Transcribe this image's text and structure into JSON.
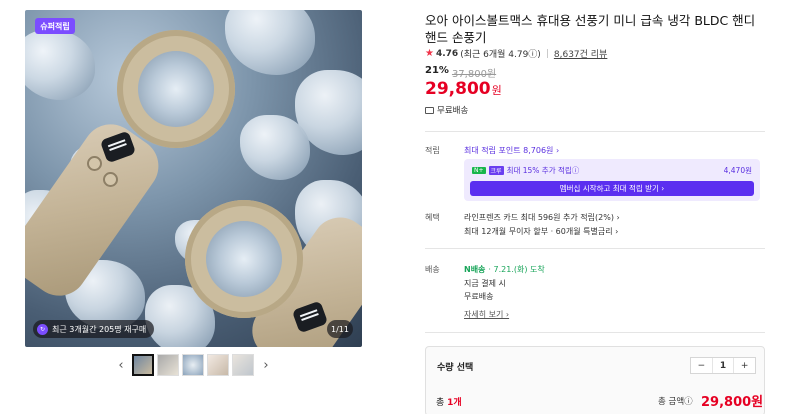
{
  "image": {
    "badge": "슈퍼적립",
    "repurchase_text": "최근 3개월간 205명 재구매",
    "page_counter": "1/11"
  },
  "thumbnails": {
    "prev": "‹",
    "next": "›",
    "count": 5,
    "active_index": 0
  },
  "product": {
    "title": "오아 아이스볼트맥스 휴대용 선풍기 미니 급속 냉각 BLDC 핸디 핸드 손풍기",
    "rating_score": "4.76",
    "rating_detail": "(최근 6개월 4.79ⓘ)",
    "review_count": "8,637건 리뷰",
    "discount_rate": "21%",
    "original_price": "37,800원",
    "price": "29,800",
    "price_unit": "원",
    "shipping": "무료배송"
  },
  "points": {
    "label": "적립",
    "max_points": "최대 적립 포인트 8,706원 ›",
    "extra_tag_n": "N+",
    "extra_tag_2": "크루",
    "extra_text": "최대 15% 추가 적립ⓘ",
    "extra_amount": "4,470원",
    "button": "멤버십 시작하고 최대 적립 받기 ›"
  },
  "benefits": {
    "label": "혜택",
    "line1": "라인프렌즈 카드 최대 596원 추가 적립(2%) ›",
    "line2": "최대 12개월 무이자 할부 · 60개월 특별금리 ›"
  },
  "delivery": {
    "label": "배송",
    "brand": "N배송",
    "arrival": "· 7.21.(화) 도착",
    "pay_text": "지금 결제 시",
    "free_text": "무료배송",
    "more": "자세히 보기 ›"
  },
  "order": {
    "qty_label": "수량 선택",
    "minus": "−",
    "qty": "1",
    "plus": "+",
    "total_prefix": "총 ",
    "total_count": "1개",
    "total_label": "총 금액ⓘ",
    "total_amount": "29,800원"
  },
  "colors": {
    "accent_red": "#e60023",
    "accent_purple": "#5b2ff0",
    "naver_green": "#19a55a"
  }
}
